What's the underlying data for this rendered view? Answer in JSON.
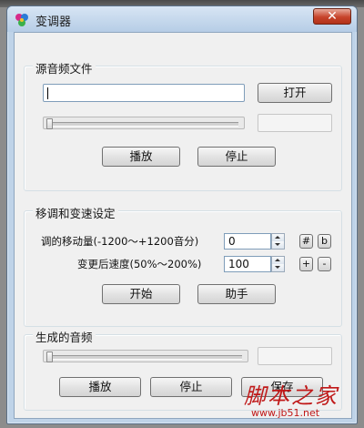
{
  "window": {
    "title": "变调器",
    "close_symbol": "✕"
  },
  "source": {
    "group_label": "源音频文件",
    "file_path": "",
    "open_button": "打开",
    "play_button": "播放",
    "stop_button": "停止"
  },
  "settings": {
    "group_label": "移调和变速设定",
    "shift_label": "调的移动量(-1200～+1200音分)",
    "shift_value": "0",
    "sharp_button": "#",
    "flat_button": "b",
    "speed_label": "变更后速度(50%～200%)",
    "speed_value": "100",
    "plus_button": "+",
    "minus_button": "-",
    "start_button": "开始",
    "assistant_button": "助手"
  },
  "output": {
    "group_label": "生成的音频",
    "play_button": "播放",
    "stop_button": "停止",
    "save_button": "保存"
  },
  "watermark": {
    "main": "脚本之家",
    "sub": "www.jb51.net"
  },
  "colors": {
    "window_frame": "#bfd3e8",
    "close_button": "#c7432b",
    "watermark": "#c01818"
  }
}
